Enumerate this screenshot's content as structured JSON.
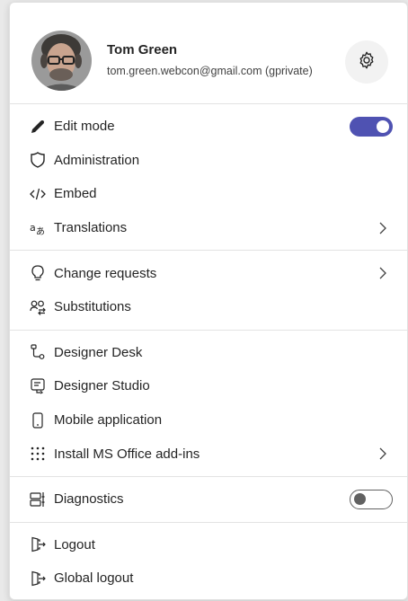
{
  "user": {
    "name": "Tom Green",
    "email": "tom.green.webcon@gmail.com (gprivate)"
  },
  "colors": {
    "accent": "#4f52b2"
  },
  "sections": {
    "edit": [
      {
        "label": "Edit mode",
        "icon": "pencil-icon",
        "toggle": true,
        "toggle_on": true
      },
      {
        "label": "Administration",
        "icon": "shield-icon"
      },
      {
        "label": "Embed",
        "icon": "code-icon"
      },
      {
        "label": "Translations",
        "icon": "translate-icon",
        "submenu": true
      }
    ],
    "requests": [
      {
        "label": "Change requests",
        "icon": "lightbulb-icon",
        "submenu": true
      },
      {
        "label": "Substitutions",
        "icon": "people-swap-icon"
      }
    ],
    "apps": [
      {
        "label": "Designer Desk",
        "icon": "flow-icon"
      },
      {
        "label": "Designer Studio",
        "icon": "studio-icon"
      },
      {
        "label": "Mobile application",
        "icon": "phone-icon"
      },
      {
        "label": "Install MS Office add-ins",
        "icon": "apps-grid-icon",
        "submenu": true
      }
    ],
    "diagnostics": [
      {
        "label": "Diagnostics",
        "icon": "diagnostics-icon",
        "toggle": true,
        "toggle_on": false
      }
    ],
    "logout": [
      {
        "label": "Logout",
        "icon": "logout-icon"
      },
      {
        "label": "Global logout",
        "icon": "global-logout-icon"
      }
    ]
  }
}
